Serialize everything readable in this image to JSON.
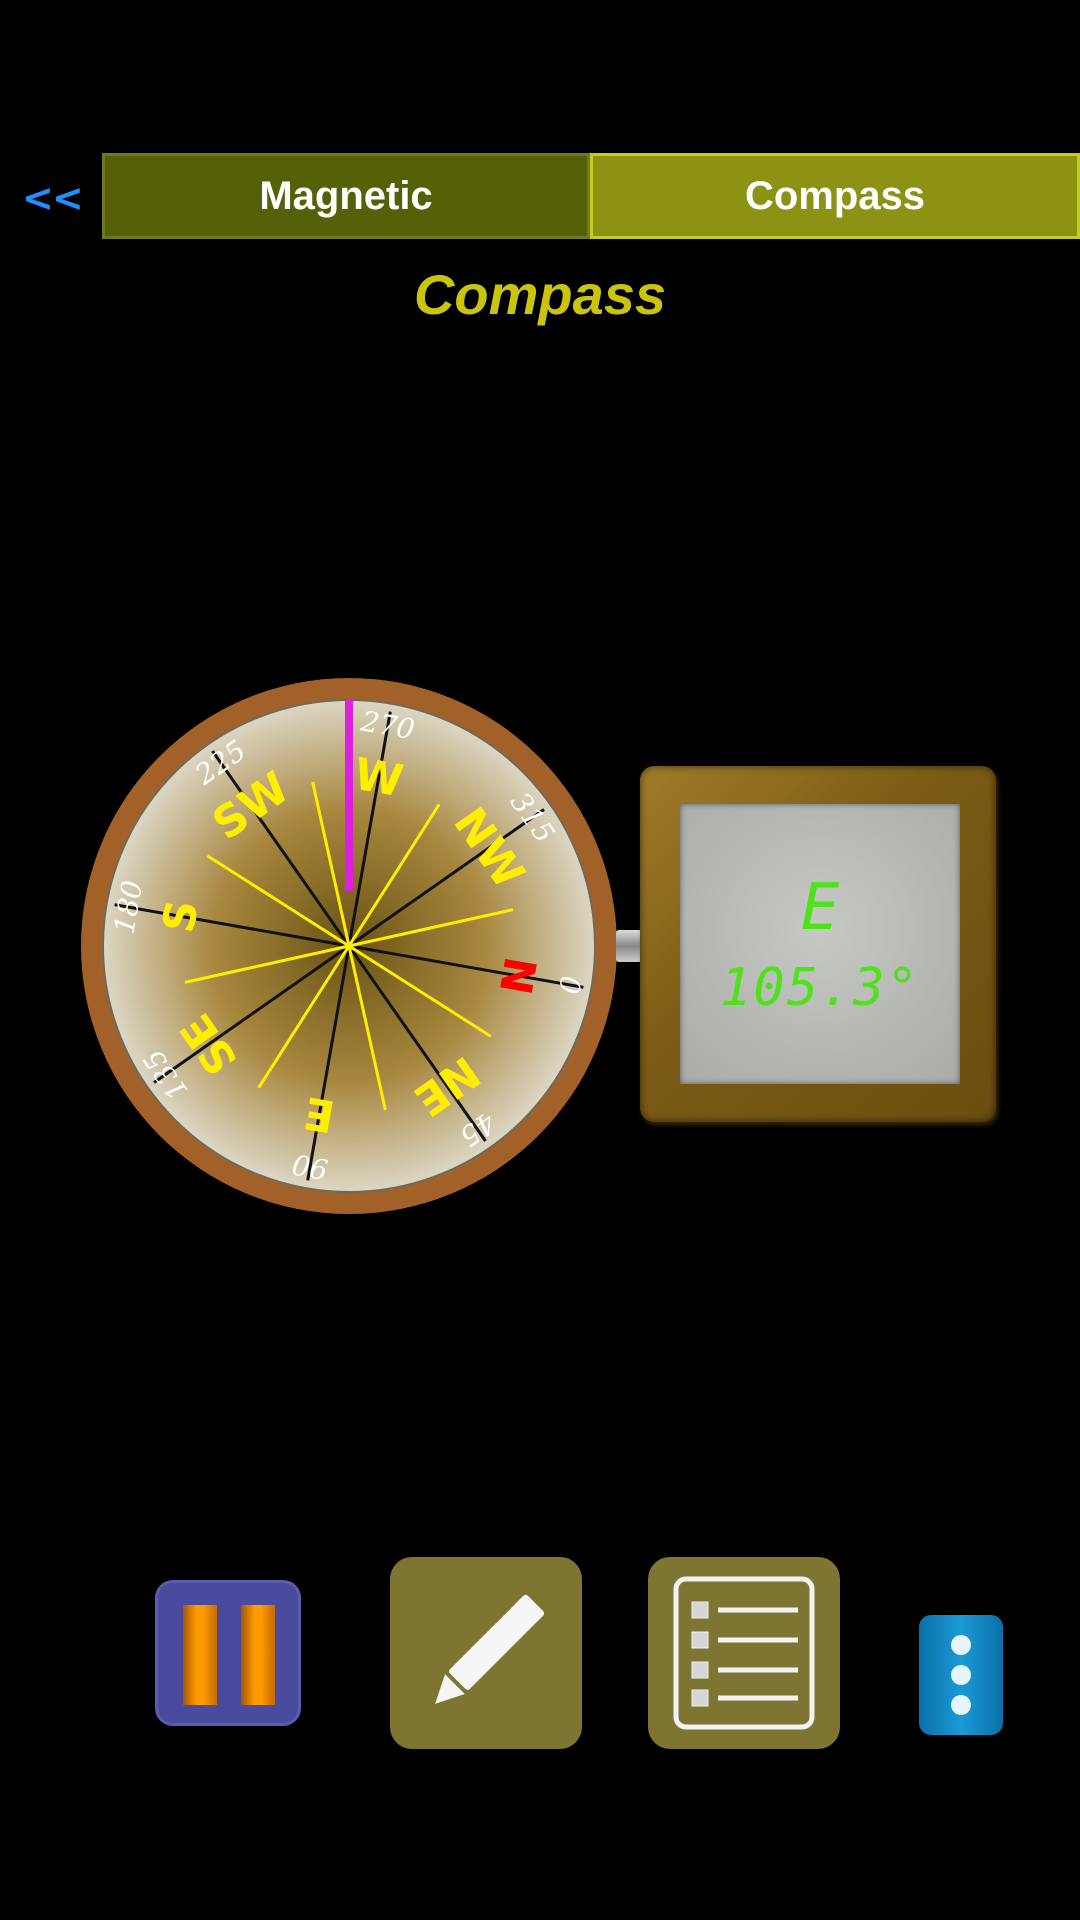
{
  "nav": {
    "back_label": "<<",
    "tabs": [
      {
        "label": "Magnetic",
        "selected": false
      },
      {
        "label": "Compass",
        "selected": true
      }
    ]
  },
  "page": {
    "title": "Compass"
  },
  "compass": {
    "dial_labels": {
      "degrees": [
        "0",
        "45",
        "90",
        "135",
        "180",
        "225",
        "270",
        "315"
      ],
      "directions": [
        "N",
        "NE",
        "E",
        "SE",
        "S",
        "SW",
        "W",
        "NW"
      ]
    },
    "needle_color": "#e01ee0",
    "north_color": "#ff0000",
    "direction_color": "#ffee00"
  },
  "display": {
    "direction": "E",
    "heading": "105.3°"
  },
  "toolbar": {
    "pause_icon": "pause-icon",
    "edit_icon": "pencil-icon",
    "list_icon": "list-icon",
    "more_icon": "more-vertical-icon"
  },
  "colors": {
    "tab_inactive": "#566009",
    "tab_active": "#8b9214",
    "title": "#c9c40e",
    "back_link": "#1e90ff",
    "lcd_text": "#4ee21a"
  }
}
